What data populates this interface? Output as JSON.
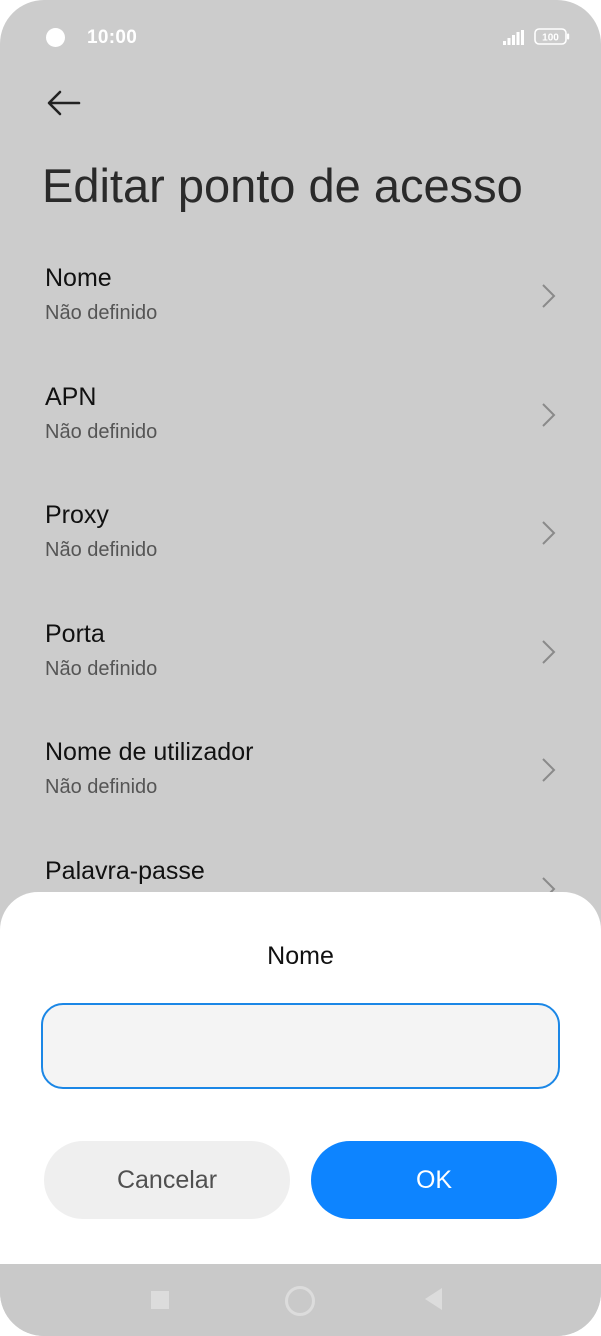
{
  "status_bar": {
    "time": "10:00",
    "battery": "100",
    "icons": [
      "notification-dot-icon",
      "signal-icon",
      "battery-icon"
    ]
  },
  "header": {
    "back_icon": "arrow-left-icon",
    "title": "Editar ponto de acesso"
  },
  "settings": [
    {
      "label": "Nome",
      "value": "Não definido"
    },
    {
      "label": "APN",
      "value": "Não definido"
    },
    {
      "label": "Proxy",
      "value": "Não definido"
    },
    {
      "label": "Porta",
      "value": "Não definido"
    },
    {
      "label": "Nome de utilizador",
      "value": "Não definido"
    },
    {
      "label": "Palavra-passe",
      "value": ""
    }
  ],
  "dialog": {
    "title": "Nome",
    "input_value": "",
    "cancel_label": "Cancelar",
    "ok_label": "OK"
  },
  "nav_bar": {
    "icons": [
      "recents-square-icon",
      "home-circle-icon",
      "back-triangle-icon"
    ]
  },
  "colors": {
    "accent": "#0d84ff",
    "input_border": "#1b87e6",
    "scrim": "#cccccc"
  }
}
